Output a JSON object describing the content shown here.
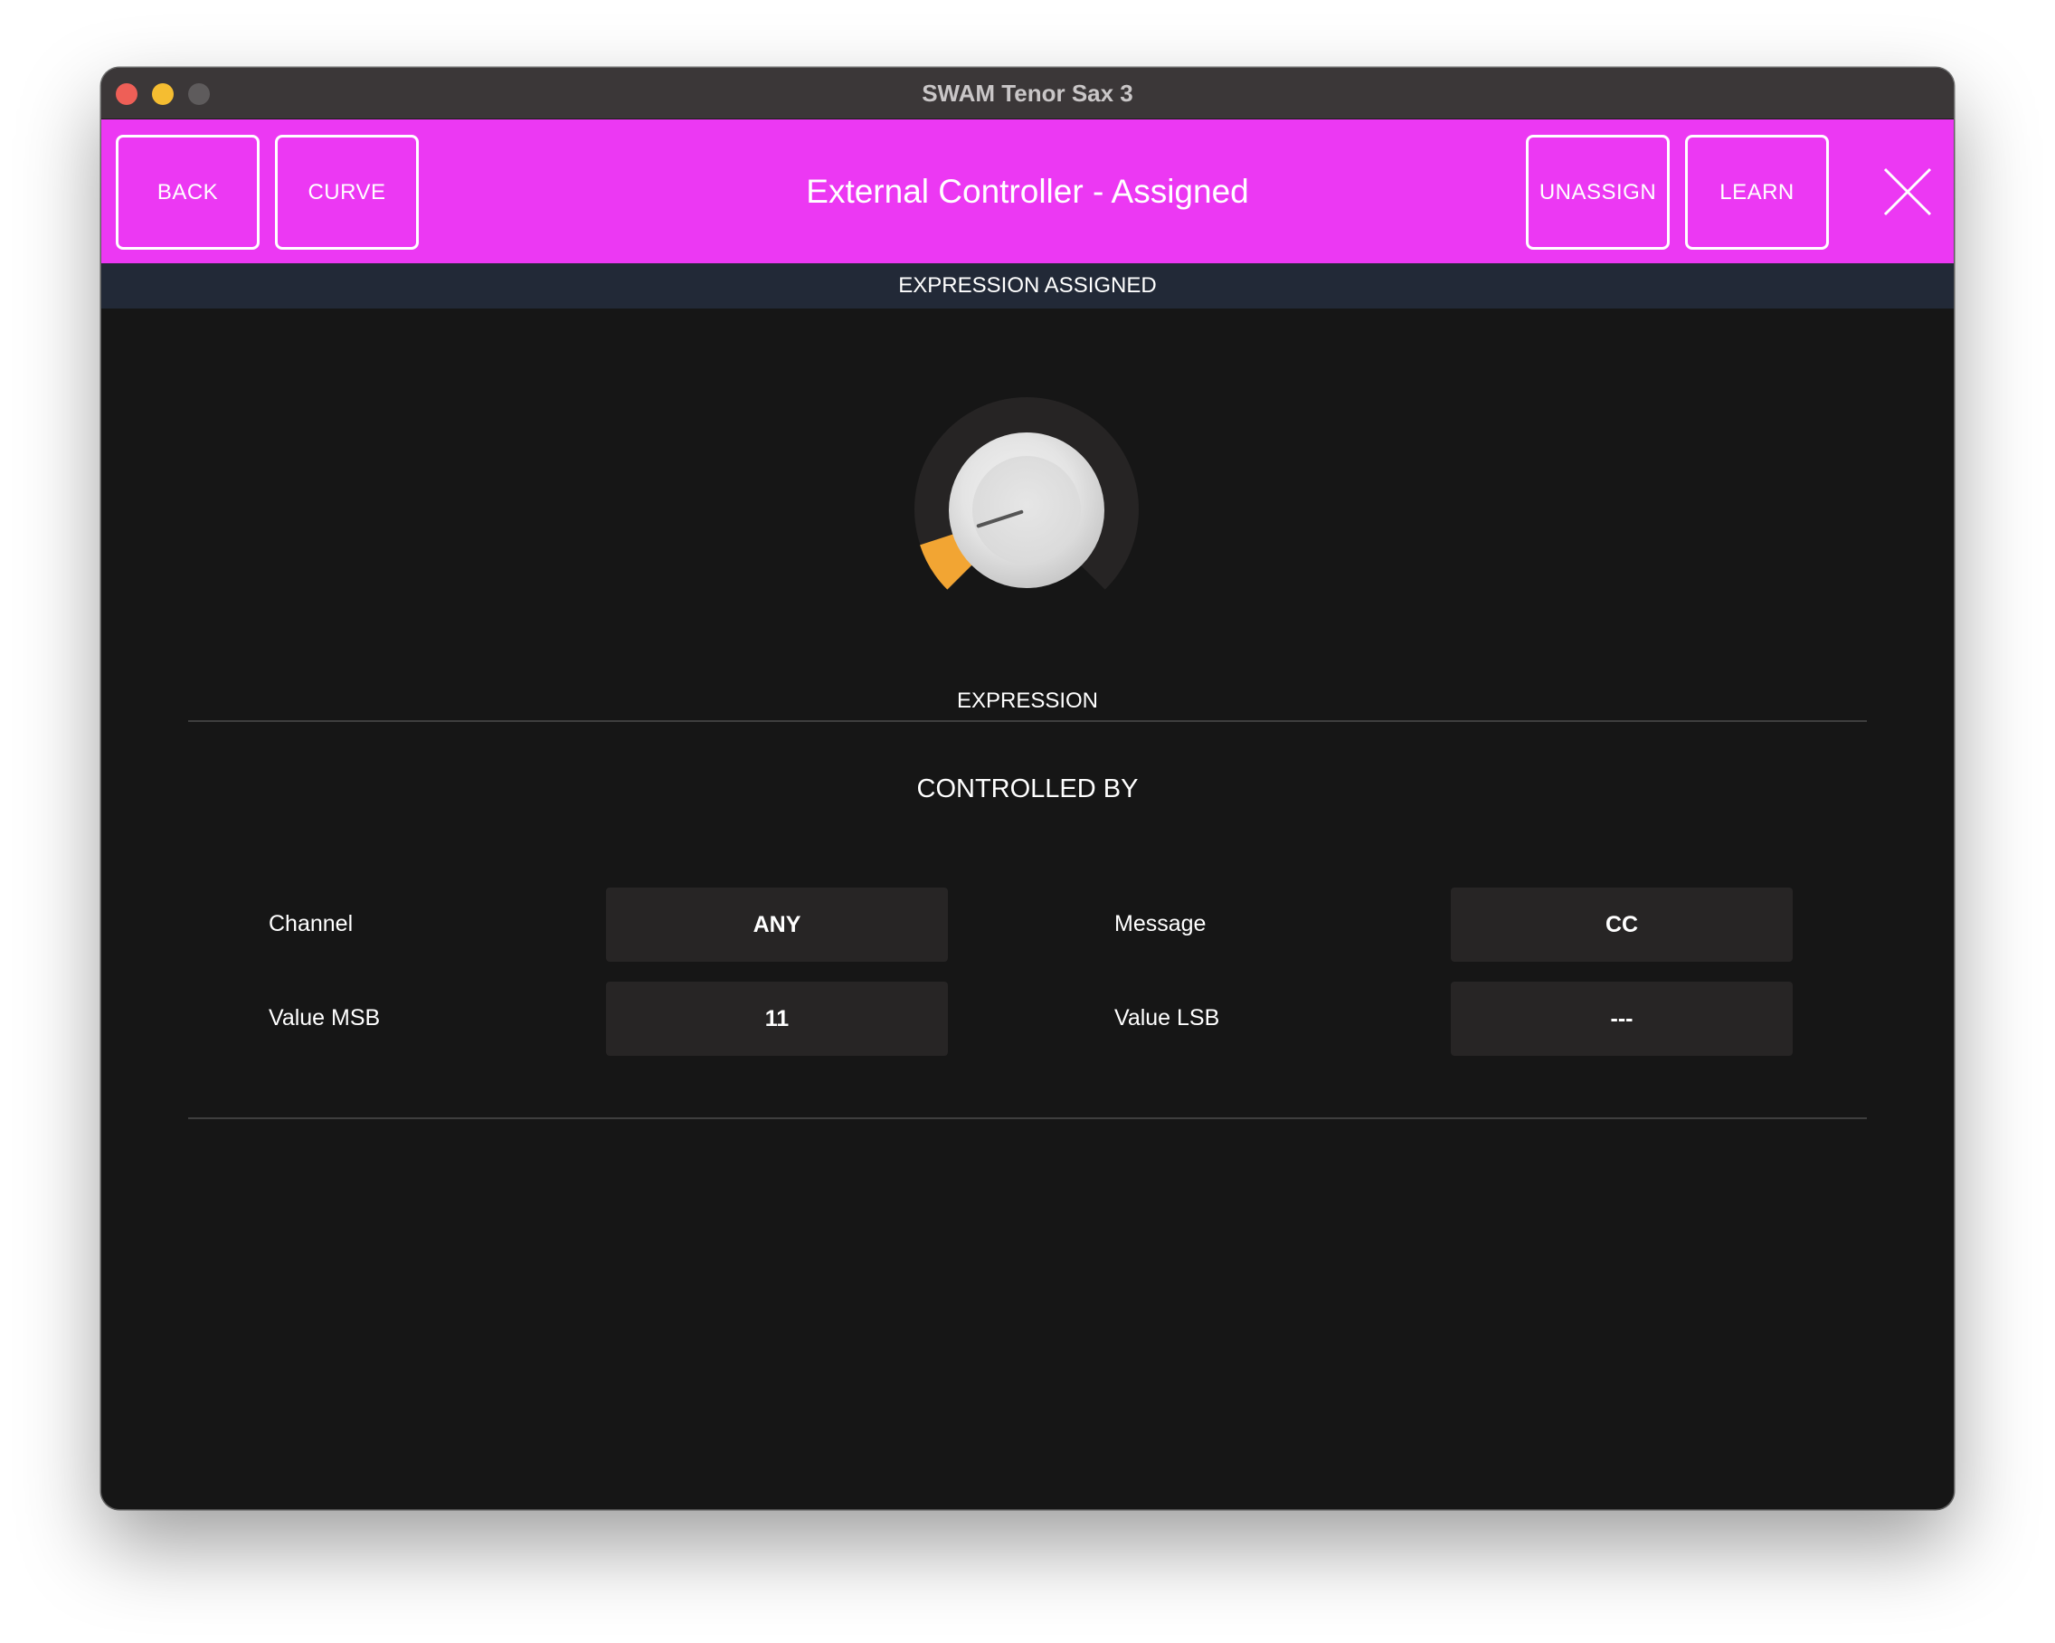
{
  "window": {
    "title": "SWAM Tenor Sax 3"
  },
  "header": {
    "back_label": "BACK",
    "curve_label": "CURVE",
    "title": "External Controller - Assigned",
    "unassign_label": "UNASSIGN",
    "learn_label": "LEARN",
    "close_icon": "close-icon"
  },
  "status": {
    "text": "EXPRESSION ASSIGNED"
  },
  "knob": {
    "label": "EXPRESSION",
    "value_fraction": 0.1,
    "accent_color": "#f2a533"
  },
  "controlled_by": {
    "title": "CONTROLLED BY",
    "fields": {
      "channel": {
        "label": "Channel",
        "value": "ANY"
      },
      "message": {
        "label": "Message",
        "value": "CC"
      },
      "value_msb": {
        "label": "Value MSB",
        "value": "11"
      },
      "value_lsb": {
        "label": "Value LSB",
        "value": "---"
      }
    }
  },
  "colors": {
    "header_bg": "#ec38f3",
    "status_bg": "#222937",
    "body_bg": "#161616",
    "field_bg": "#272525"
  }
}
